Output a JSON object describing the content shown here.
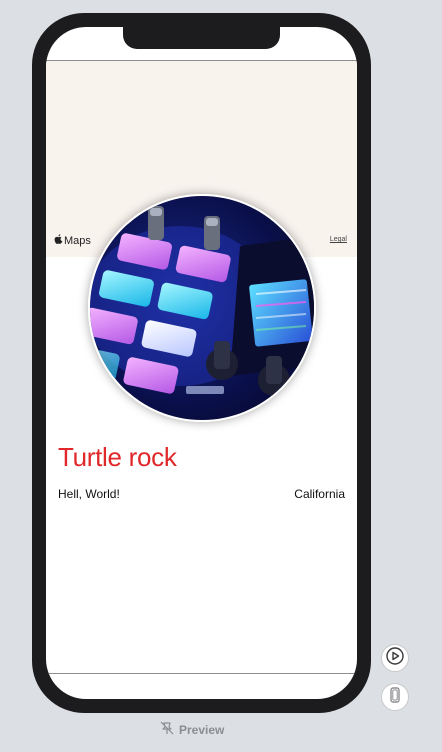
{
  "map": {
    "attribution": "Maps",
    "legal_label": "Legal"
  },
  "landmark": {
    "name": "Turtle rock",
    "subtitle": "Hell, World!",
    "state": "California"
  },
  "canvas": {
    "preview_label": "Preview",
    "live_button_icon": "play-circle-icon",
    "device_button_icon": "device-icon"
  },
  "colors": {
    "title": "#e0282a",
    "map_background": "#f9f3ee",
    "phone_frame": "#1c1c1e",
    "canvas_background": "#dcdfe3"
  }
}
